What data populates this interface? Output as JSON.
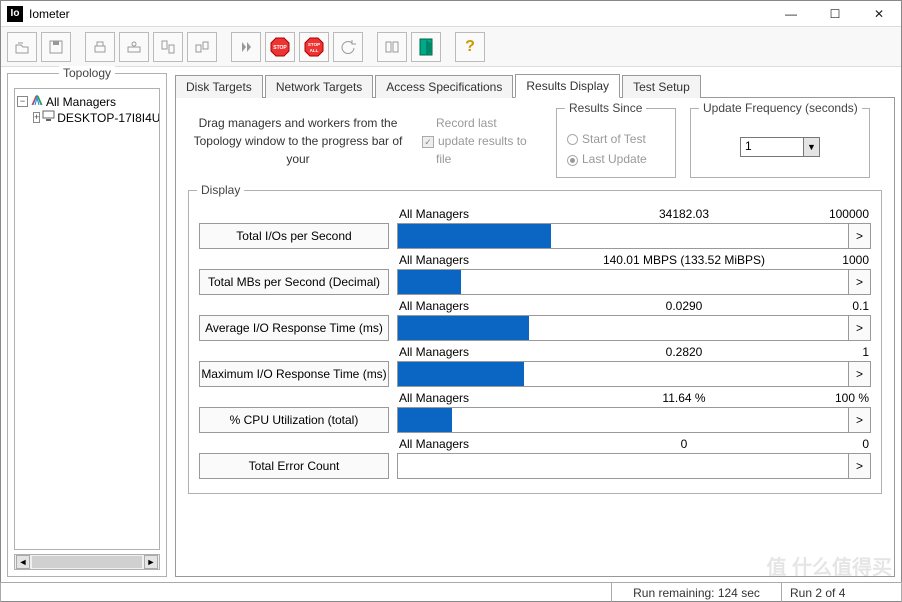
{
  "window": {
    "title": "Iometer",
    "app_icon_text": "Io"
  },
  "topology": {
    "legend": "Topology",
    "root": "All Managers",
    "child": "DESKTOP-17I8I4U"
  },
  "tabs": {
    "items": [
      {
        "label": "Disk Targets",
        "active": false
      },
      {
        "label": "Network Targets",
        "active": false
      },
      {
        "label": "Access Specifications",
        "active": false
      },
      {
        "label": "Results Display",
        "active": true
      },
      {
        "label": "Test Setup",
        "active": false
      }
    ]
  },
  "top_controls": {
    "drag_text": "Drag managers and workers from the Topology window to the progress bar of your",
    "record_label": "Record last update results to file",
    "results_since": {
      "legend": "Results Since",
      "opt1": "Start of Test",
      "opt2": "Last Update",
      "selected": 2
    },
    "update_freq": {
      "legend": "Update Frequency (seconds)",
      "value": "1"
    }
  },
  "display": {
    "legend": "Display",
    "metrics": [
      {
        "label": "Total I/Os per Second",
        "name": "All Managers",
        "value": "34182.03",
        "max": "100000",
        "pct": 34
      },
      {
        "label": "Total MBs per Second (Decimal)",
        "name": "All Managers",
        "value": "140.01 MBPS (133.52 MiBPS)",
        "max": "1000",
        "pct": 14
      },
      {
        "label": "Average I/O Response Time (ms)",
        "name": "All Managers",
        "value": "0.0290",
        "max": "0.1",
        "pct": 29
      },
      {
        "label": "Maximum I/O Response Time (ms)",
        "name": "All Managers",
        "value": "0.2820",
        "max": "1",
        "pct": 28
      },
      {
        "label": "% CPU Utilization (total)",
        "name": "All Managers",
        "value": "11.64 %",
        "max": "100 %",
        "pct": 12
      },
      {
        "label": "Total Error Count",
        "name": "All Managers",
        "value": "0",
        "max": "0",
        "pct": 0
      }
    ]
  },
  "statusbar": {
    "run_remaining": "Run remaining: 124 sec",
    "run_of": "Run 2 of 4"
  },
  "watermark": "值  什么值得买",
  "icons": {
    "stop": "STOP",
    "stop_all": "STOP\nALL",
    "question": "?",
    "chevron": ">",
    "dropdown": "▼",
    "minimize": "—",
    "maximize": "☐",
    "close": "✕",
    "check": "✓",
    "minus": "−",
    "plus": "+",
    "left": "◄",
    "right": "►"
  }
}
